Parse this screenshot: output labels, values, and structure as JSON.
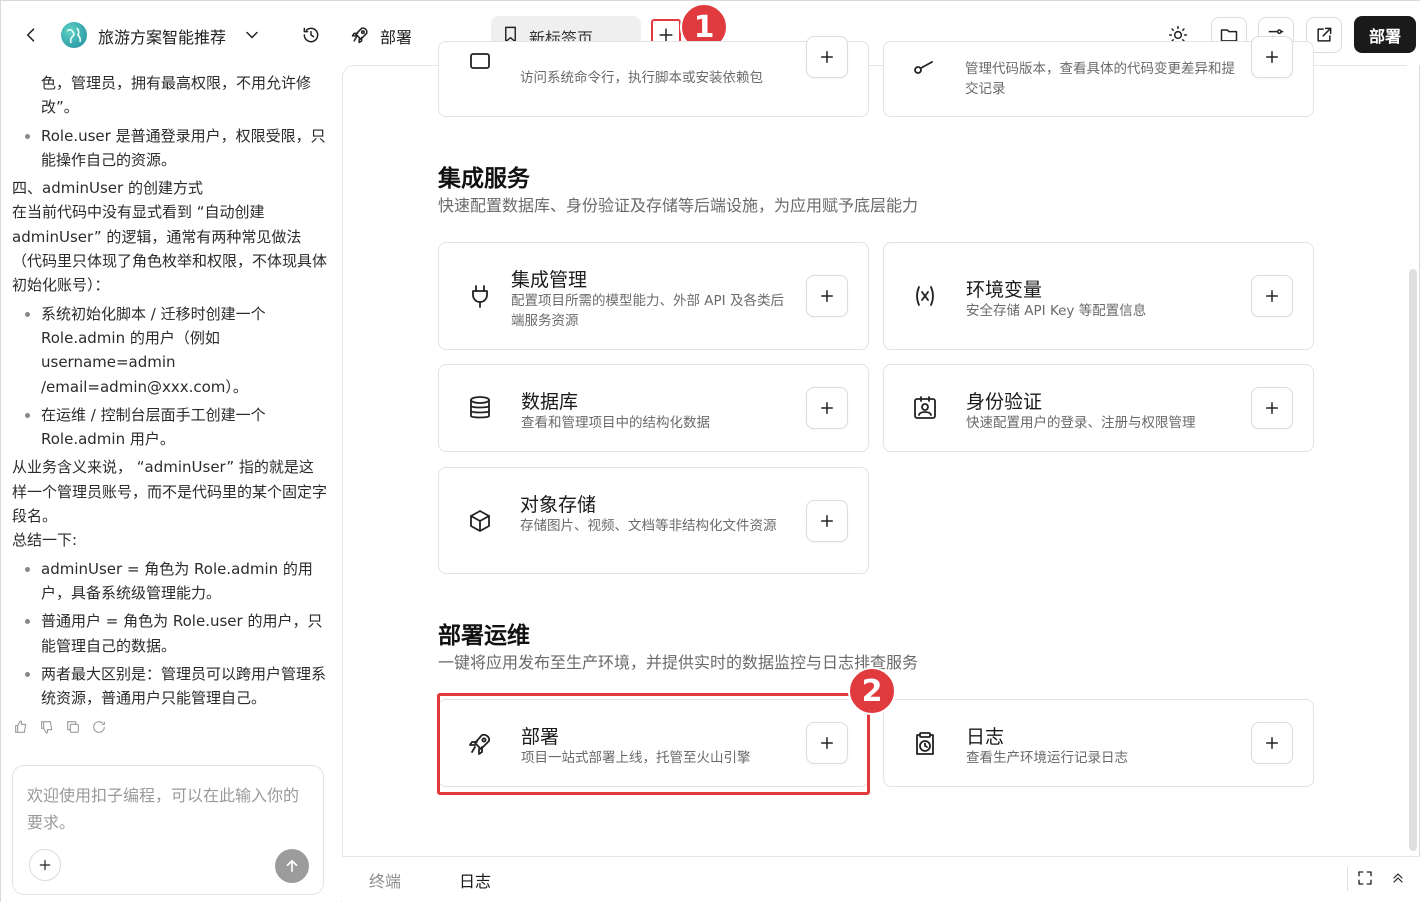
{
  "topbar": {
    "app_title": "旅游方案智能推荐",
    "deploy_tab": "部署",
    "new_tab": "新标签页",
    "deploy_button": "部署"
  },
  "annotations": {
    "badge_1": "1",
    "badge_2": "2"
  },
  "chat": {
    "para_top": "色，管理员，拥有最高权限，不用允许修改”。",
    "bullet_user": "Role.user 是普通登录用户，权限受限，只能操作自己的资源。",
    "section4_heading": "四、adminUser 的创建方式",
    "section4_body": "在当前代码中没有显式看到 “自动创建 adminUser” 的逻辑，通常有两种常见做法（代码里只体现了角色枚举和权限，不体现具体初始化账号）：",
    "bullets_create": [
      "系统初始化脚本 / 迁移时创建一个 Role.admin 的用户（例如 username=admin /email=admin@xxx.com）。",
      "在运维 / 控制台层面手工创建一个 Role.admin 用户。"
    ],
    "business_meaning": "从业务含义来说， “adminUser” 指的就是这样一个管理员账号，而不是代码里的某个固定字段名。",
    "summary_heading": "总结一下:",
    "bullets_summary": [
      "adminUser = 角色为 Role.admin 的用户，具备系统级管理能力。",
      "普通用户 = 角色为 Role.user 的用户，只能管理自己的数据。",
      "两者最大区别是：管理员可以跨用户管理系统资源，普通用户只能管理自己。"
    ],
    "input_placeholder": "欢迎使用扣子编程，可以在此输入你的要求。"
  },
  "main": {
    "top_cards": [
      {
        "desc": "访问系统命令行，执行脚本或安装依赖包"
      },
      {
        "desc": "管理代码版本，查看具体的代码变更差异和提交记录"
      }
    ],
    "integration": {
      "title": "集成服务",
      "desc": "快速配置数据库、身份验证及存储等后端设施，为应用赋予底层能力",
      "cards": [
        {
          "title": "集成管理",
          "desc": "配置项目所需的模型能力、外部 API 及各类后端服务资源",
          "icon": "plug-icon"
        },
        {
          "title": "环境变量",
          "desc": "安全存储 API Key 等配置信息",
          "icon": "variable-icon"
        },
        {
          "title": "数据库",
          "desc": "查看和管理项目中的结构化数据",
          "icon": "database-icon"
        },
        {
          "title": "身份验证",
          "desc": "快速配置用户的登录、注册与权限管理",
          "icon": "user-badge-icon"
        },
        {
          "title": "对象存储",
          "desc": "存储图片、视频、文档等非结构化文件资源",
          "icon": "box-icon"
        }
      ]
    },
    "ops": {
      "title": "部署运维",
      "desc": "一键将应用发布至生产环境，并提供实时的数据监控与日志排查服务",
      "cards": [
        {
          "title": "部署",
          "desc": "项目一站式部署上线，托管至火山引擎",
          "icon": "rocket-icon"
        },
        {
          "title": "日志",
          "desc": "查看生产环境运行记录日志",
          "icon": "log-clock-icon"
        }
      ]
    }
  },
  "bottombar": {
    "terminal": "终端",
    "logs": "日志"
  },
  "colors": {
    "highlight": "#e0393e",
    "primary_button": "#1a1a1a"
  }
}
